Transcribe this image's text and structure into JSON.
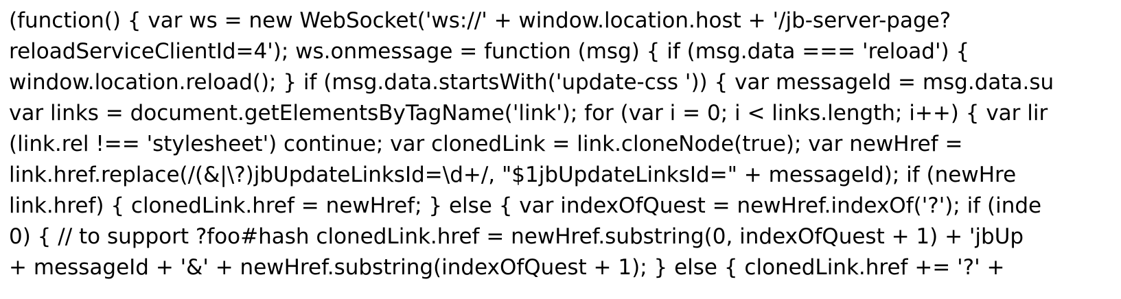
{
  "lines": [
    "(function() { var ws = new WebSocket('ws://' + window.location.host + '/jb-server-page?",
    "reloadServiceClientId=4'); ws.onmessage = function (msg) { if (msg.data === 'reload') {",
    "window.location.reload(); } if (msg.data.startsWith('update-css ')) { var messageId = msg.data.su",
    "var links = document.getElementsByTagName('link'); for (var i = 0; i < links.length; i++) { var lir",
    "(link.rel !== 'stylesheet') continue; var clonedLink = link.cloneNode(true); var newHref =",
    "link.href.replace(/(&|\\?)jbUpdateLinksId=\\d+/, \"$1jbUpdateLinksId=\" + messageId); if (newHre",
    "link.href) { clonedLink.href = newHref; } else { var indexOfQuest = newHref.indexOf('?'); if (inde",
    "0) { // to support ?foo#hash clonedLink.href = newHref.substring(0, indexOfQuest + 1) + 'jbUp",
    "+ messageId + '&' + newHref.substring(indexOfQuest + 1); } else { clonedLink.href += '?' +"
  ]
}
